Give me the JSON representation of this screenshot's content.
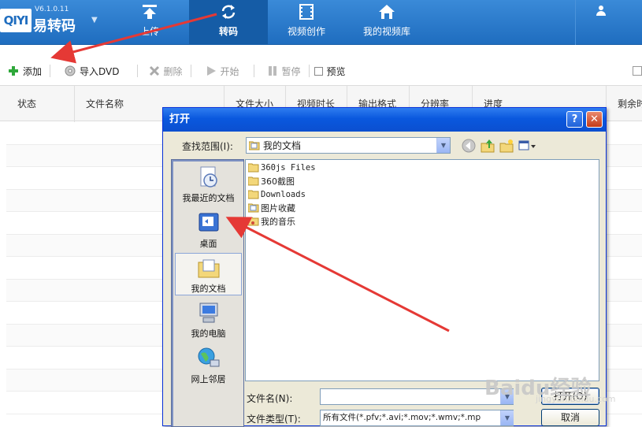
{
  "app": {
    "badge": "QIYI",
    "version": "V6.1.0.11",
    "name": "易转码",
    "dropdown_glyph": "▼"
  },
  "nav": {
    "tabs": [
      {
        "label": "上传",
        "icon": "upload-icon"
      },
      {
        "label": "转码",
        "icon": "convert-icon",
        "active": true
      },
      {
        "label": "视频创作",
        "icon": "film-icon"
      },
      {
        "label": "我的视频库",
        "icon": "home-icon"
      }
    ],
    "user_icon": "user-icon"
  },
  "toolbar": {
    "add": "添加",
    "import_dvd": "导入DVD",
    "delete": "删除",
    "start": "开始",
    "pause": "暂停",
    "preview": "预览"
  },
  "table": {
    "columns": [
      "状态",
      "文件名称",
      "文件大小",
      "视频时长",
      "输出格式",
      "分辨率",
      "进度",
      "剩余时"
    ],
    "rows": []
  },
  "dialog": {
    "title": "打开",
    "help": "?",
    "close": "✕",
    "look_in_label": "查找范围(I):",
    "look_in_value": "我的文档",
    "places": [
      {
        "label": "我最近的文档",
        "icon": "recent-docs-icon"
      },
      {
        "label": "桌面",
        "icon": "desktop-icon"
      },
      {
        "label": "我的文档",
        "icon": "my-documents-icon",
        "selected": true
      },
      {
        "label": "我的电脑",
        "icon": "my-computer-icon"
      },
      {
        "label": "网上邻居",
        "icon": "network-icon"
      }
    ],
    "files": [
      {
        "name": "360js Files",
        "icon": "folder-icon"
      },
      {
        "name": "360截图",
        "icon": "folder-icon"
      },
      {
        "name": "Downloads",
        "icon": "folder-icon"
      },
      {
        "name": "图片收藏",
        "icon": "pictures-folder-icon"
      },
      {
        "name": "我的音乐",
        "icon": "music-folder-icon"
      }
    ],
    "filename_label": "文件名(N):",
    "filename_value": "",
    "filetype_label": "文件类型(T):",
    "filetype_value": "所有文件(*.pfv;*.avi;*.mov;*.wmv;*.mp",
    "open_button": "打开(O)",
    "cancel_button": "取消"
  },
  "watermark": {
    "text": "Baidu经验",
    "sub": "jingyan.baidu.com"
  },
  "colors": {
    "topbar": "#1f6dbf",
    "dialog_title": "#0a58de",
    "annotation_arrow": "#e53935"
  }
}
